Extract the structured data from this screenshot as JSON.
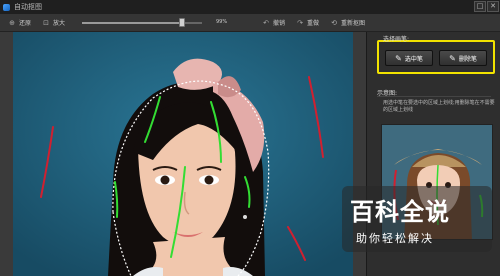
{
  "window": {
    "title": "自动抠图",
    "max_btn": "□",
    "close_btn": "✕"
  },
  "toolbar": {
    "undo_label": "还原",
    "zoom_label": "放大",
    "zoom_value": "99%",
    "zoom_level": 0.83,
    "redo_label": "撤销",
    "forward_label": "重做",
    "reset_label": "重新抠图"
  },
  "panel": {
    "brush_heading": "选择画笔:",
    "select_brush_label": "选中笔",
    "delete_brush_label": "删除笔",
    "example_heading": "示意图:",
    "example_text": "用选中笔在要选中的区域上划线;用删除笔在不需要的区域上划线"
  },
  "watermark": {
    "title": "百科全说",
    "subtitle": "助你轻松解决"
  },
  "colors": {
    "canvas_bg": "#1d5c78",
    "select_stroke": "#33dd33",
    "delete_stroke": "#d02030",
    "highlight_border": "#f2e300"
  }
}
